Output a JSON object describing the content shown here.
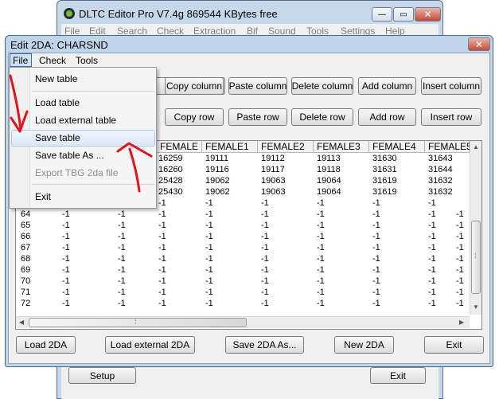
{
  "main_window": {
    "title": "DLTC Editor Pro V7.4g  869544 KBytes free",
    "caption_minimize": "—",
    "caption_restore": "▭",
    "caption_close": "✕",
    "menu": [
      "File",
      "Edit",
      "Search",
      "Check",
      "Extraction",
      "Bif",
      "Sound",
      "Tools",
      "Settings",
      "Help"
    ],
    "setup_label": "Setup",
    "exit_label": "Exit"
  },
  "dialog": {
    "title": "Edit 2DA: CHARSND",
    "close": "✕",
    "menu": [
      "File",
      "Check",
      "Tools"
    ],
    "column_buttons": [
      "Copy column",
      "Paste column",
      "Delete column",
      "Add column",
      "Insert column"
    ],
    "row_buttons": [
      "Copy row",
      "Paste row",
      "Delete row",
      "Add row",
      "Insert row"
    ],
    "bottom_buttons": [
      "Load 2DA",
      "Load external 2DA",
      "Save 2DA As...",
      "New 2DA",
      "Exit"
    ]
  },
  "file_menu": {
    "items": [
      "New table",
      "Load table",
      "Load external table",
      "Save table",
      "Save table As ...",
      "Export TBG 2da file",
      "Exit"
    ],
    "highlighted": "Save table",
    "disabled": "Export TBG 2da file"
  },
  "grid": {
    "headers": [
      "FEMALE",
      "FEMALE1",
      "FEMALE2",
      "FEMALE3",
      "FEMALE4",
      "FEMALE5"
    ],
    "top_rows": [
      [
        "16259",
        "19111",
        "19112",
        "19113",
        "31630",
        "31643"
      ],
      [
        "16260",
        "19116",
        "19117",
        "19118",
        "31631",
        "31644"
      ],
      [
        "25428",
        "19062",
        "19063",
        "19064",
        "31619",
        "31632"
      ],
      [
        "25430",
        "19062",
        "19063",
        "19064",
        "31619",
        "31632"
      ]
    ],
    "partial_row": [
      "-1",
      "-1",
      "-1",
      "-1",
      "-1",
      "-1"
    ],
    "rows": [
      [
        "64",
        "-1",
        "-1",
        "-1",
        "-1",
        "-1",
        "-1",
        "-1",
        "-1",
        "-1"
      ],
      [
        "65",
        "-1",
        "-1",
        "-1",
        "-1",
        "-1",
        "-1",
        "-1",
        "-1",
        "-1"
      ],
      [
        "66",
        "-1",
        "-1",
        "-1",
        "-1",
        "-1",
        "-1",
        "-1",
        "-1",
        "-1"
      ],
      [
        "67",
        "-1",
        "-1",
        "-1",
        "-1",
        "-1",
        "-1",
        "-1",
        "-1",
        "-1"
      ],
      [
        "68",
        "-1",
        "-1",
        "-1",
        "-1",
        "-1",
        "-1",
        "-1",
        "-1",
        "-1"
      ],
      [
        "69",
        "-1",
        "-1",
        "-1",
        "-1",
        "-1",
        "-1",
        "-1",
        "-1",
        "-1"
      ],
      [
        "70",
        "-1",
        "-1",
        "-1",
        "-1",
        "-1",
        "-1",
        "-1",
        "-1",
        "-1"
      ],
      [
        "71",
        "-1",
        "-1",
        "-1",
        "-1",
        "-1",
        "-1",
        "-1",
        "-1",
        "-1"
      ],
      [
        "72",
        "-1",
        "-1",
        "-1",
        "-1",
        "-1",
        "-1",
        "-1",
        "-1",
        "-1"
      ]
    ],
    "scroll_up": "▲",
    "scroll_down": "▼",
    "scroll_left": "◀",
    "scroll_right": "▶",
    "grip": "⁞"
  },
  "colors": {
    "annotation": "#e0141e",
    "highlight": "#dbe8f6",
    "window_frame": "#c1d5ea"
  }
}
